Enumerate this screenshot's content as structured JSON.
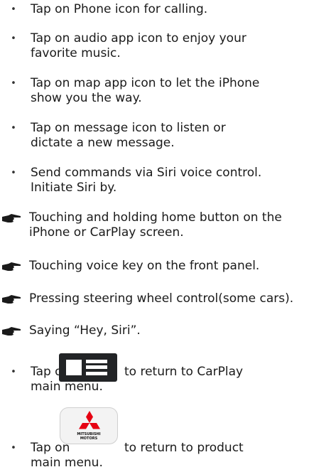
{
  "bullets": [
    {
      "lines": [
        "Tap on Phone icon for calling."
      ]
    },
    {
      "lines": [
        "Tap on audio app icon to enjoy your",
        "favorite music."
      ]
    },
    {
      "lines": [
        "Tap on map app icon to let the iPhone",
        "show you the way."
      ]
    },
    {
      "lines": [
        "Tap on message icon to listen or",
        "dictate a new message."
      ]
    },
    {
      "lines": [
        "Send commands via Siri voice control.",
        "Initiate Siri by."
      ]
    }
  ],
  "siri_methods": [
    {
      "lines": [
        "Touching and holding home button on the",
        "iPhone or CarPlay screen."
      ]
    },
    {
      "lines": [
        "Touching voice key on the front panel."
      ]
    },
    {
      "lines": [
        "Pressing steering wheel control(some cars)."
      ]
    },
    {
      "lines": [
        "Saying “Hey, Siri”."
      ]
    }
  ],
  "bullet_symbol": "•",
  "carplay_item": {
    "prefix": "Tap on",
    "suffix": "to return to CarPlay",
    "line2": "main menu.",
    "icon": "carplay-menu-icon"
  },
  "product_item": {
    "prefix": "Tap on",
    "suffix": "to return to product",
    "line2": "main menu.",
    "icon": "mitsubishi-motors-icon",
    "logo_lines": [
      "MITSUBISHI",
      "MOTORS"
    ]
  },
  "colors": {
    "text": "#1a1a1a",
    "logo_red": "#e60012",
    "carplay_bg": "#222426"
  }
}
